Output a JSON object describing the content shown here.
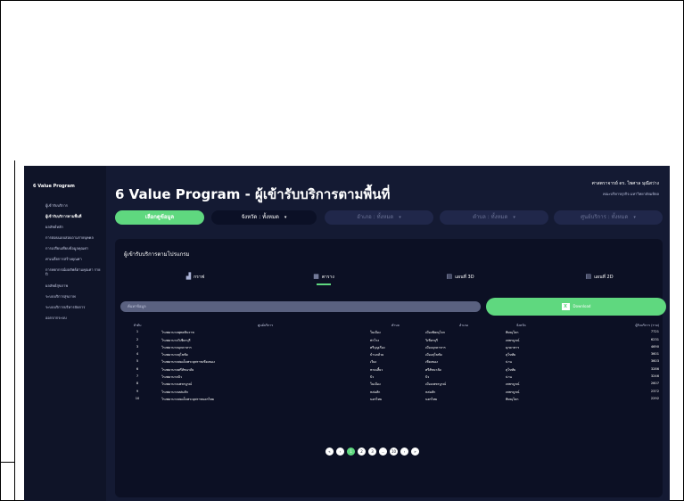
{
  "sidebar": {
    "brand": "6 Value Program",
    "items": [
      {
        "label": "ผู้เข้ารับบริการ"
      },
      {
        "label": "ผู้เข้ารับบริการตามพื้นที่"
      },
      {
        "label": "ผลลัพธ์หลัก"
      },
      {
        "label": "การตอบแบบสอบถามรายบุคคล"
      },
      {
        "label": "การเปรียบเทียบข้อมูลคุณค่า"
      },
      {
        "label": "ค่าเฉลี่ยการสร้างคุณค่า"
      },
      {
        "label": "การพยากรณ์ผลลัพธ์ตามคุณค่า รายปี"
      },
      {
        "label": "ผลลัพธ์สุขภาพ"
      },
      {
        "label": "ระบบบริการสุขภาพ"
      },
      {
        "label": "ระบบบริการบริหารจัดการ"
      },
      {
        "label": "ออกจากระบบ"
      }
    ]
  },
  "header": {
    "title": "6 Value Program - ผู้เข้ารับบริการตามพื้นที่",
    "user_name": "ศาสตราจารย์ ดร. ไพศาล มุณีสว่าง",
    "user_org": "คณะบริหารธุรกิจ มหาวิทยาลัยมหิดล"
  },
  "filters": {
    "select_data_label": "เลือกดูข้อมูล",
    "province": "จังหวัด : ทั้งหมด",
    "district": "อำเภอ : ทั้งหมด",
    "subdistrict": "ตำบล : ทั้งหมด",
    "service_unit": "ศูนย์บริการ : ทั้งหมด"
  },
  "panel": {
    "title": "ผู้เข้ารับบริการตามโปรแกรม",
    "tabs": [
      {
        "label": "กราฟ",
        "icon": "bar-chart-icon"
      },
      {
        "label": "ตาราง",
        "icon": "table-icon"
      },
      {
        "label": "แผนที่ 3D",
        "icon": "map-icon"
      },
      {
        "label": "แผนที่ 2D",
        "icon": "map-icon"
      }
    ],
    "search_placeholder": "ค้นหาข้อมูล",
    "download_label": "Download"
  },
  "table": {
    "headers": [
      "ลำดับ",
      "ศูนย์บริการ",
      "ตำบล",
      "อำเภอ",
      "จังหวัด",
      "ผู้รับบริการ (ราย)"
    ],
    "rows": [
      [
        "1",
        "โรงพยาบาลพุทธชินราช",
        "ในเมือง",
        "เมืองพิษณุโลก",
        "พิษณุโลก",
        "7721"
      ],
      [
        "2",
        "โรงพยาบาลวิเชียรบุรี",
        "ท่าโรง",
        "วิเชียรบุรี",
        "เพชรบูรณ์",
        "6231"
      ],
      [
        "3",
        "โรงพยาบาลมุกดาหาร",
        "ศรีบุญเรือง",
        "เมืองมุกดาหาร",
        "มุกดาหาร",
        "4690"
      ],
      [
        "4",
        "โรงพยาบาลสุโขทัย",
        "บ้านกล้วย",
        "เมืองสุโขทัย",
        "สุโขทัย",
        "3601"
      ],
      [
        "5",
        "โรงพยาบาลสมเด็จพระยุพราชเชียงของ",
        "เวียง",
        "เชียงของ",
        "น่าน",
        "3603"
      ],
      [
        "6",
        "โรงพยาบาลศรีสัชนาลัย",
        "หาดเสี้ยว",
        "ศรีสัชนาลัย",
        "สุโขทัย",
        "3286"
      ],
      [
        "7",
        "โรงพยาบาลปัว",
        "ปัว",
        "ปัว",
        "น่าน",
        "3246"
      ],
      [
        "8",
        "โรงพยาบาลเพชรบูรณ์",
        "ในเมือง",
        "เมืองเพชรบูรณ์",
        "เพชรบูรณ์",
        "2607"
      ],
      [
        "9",
        "โรงพยาบาลหล่มสัก",
        "หล่มสัก",
        "หล่มสัก",
        "เพชรบูรณ์",
        "2372"
      ],
      [
        "10",
        "โรงพยาบาลสมเด็จพระยุพราชนครไทย",
        "นครไทย",
        "นครไทย",
        "พิษณุโลก",
        "2292"
      ]
    ]
  },
  "pagination": {
    "items": [
      "«",
      "‹",
      "1",
      "2",
      "3",
      "...",
      "10",
      "›",
      "»"
    ],
    "active": "1"
  },
  "colors": {
    "accent": "#5fd87f",
    "background": "#141a33",
    "panel": "#0c1024",
    "sidebar": "#0f1428"
  }
}
